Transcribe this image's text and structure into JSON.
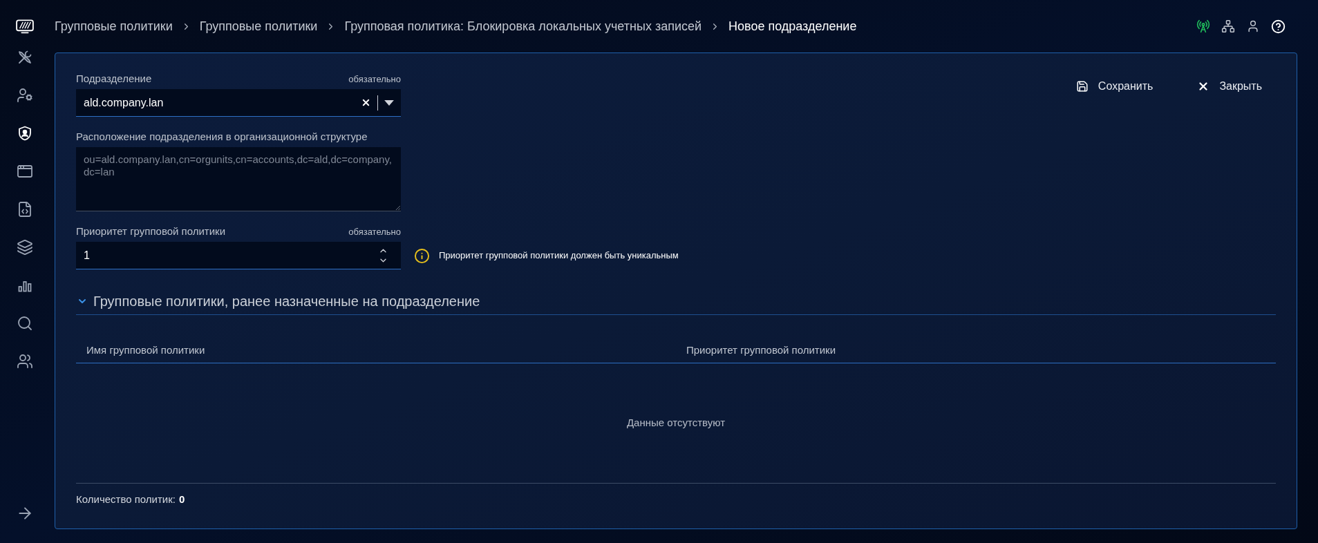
{
  "header": {
    "breadcrumbs": [
      {
        "label": "Групповые политики",
        "current": false
      },
      {
        "label": "Групповые политики",
        "current": false
      },
      {
        "label": "Групповая политика: Блокировка локальных учетных записей",
        "current": false
      },
      {
        "label": "Новое подразделение",
        "current": true
      }
    ],
    "connection": {
      "online": true
    }
  },
  "sidebar": {
    "items": [
      {
        "selected": false
      },
      {
        "selected": false
      },
      {
        "selected": true
      },
      {
        "selected": false
      },
      {
        "selected": false
      },
      {
        "selected": false
      },
      {
        "selected": false
      },
      {
        "selected": false
      },
      {
        "selected": false
      }
    ]
  },
  "form": {
    "fields": [
      {
        "kind": "select",
        "label": "Подразделение",
        "required_note": "обязательно",
        "value": "ald.company.lan"
      },
      {
        "kind": "textarea",
        "label": "Расположение подразделения в организационной структуре",
        "value": "ou=ald.company.lan,cn=orgunits,cn=accounts,dc=ald,dc=company,dc=lan",
        "disabled": true
      },
      {
        "kind": "number",
        "label": "Приоритет групповой политики",
        "required_note": "обязательно",
        "value": "1",
        "hint": "Приоритет групповой политики должен быть уникальным"
      }
    ]
  },
  "actions": [
    {
      "kind": "save",
      "label": "Сохранить"
    },
    {
      "kind": "close",
      "label": "Закрыть"
    }
  ],
  "section": {
    "title": "Групповые политики, ранее назначенные на подразделение",
    "expanded": true,
    "table": {
      "columns": [
        "Имя групповой политики",
        "Приоритет групповой политики"
      ],
      "empty_text": "Данные отсутствуют"
    },
    "footer": {
      "label": "Количество политик:",
      "count": "0"
    }
  }
}
